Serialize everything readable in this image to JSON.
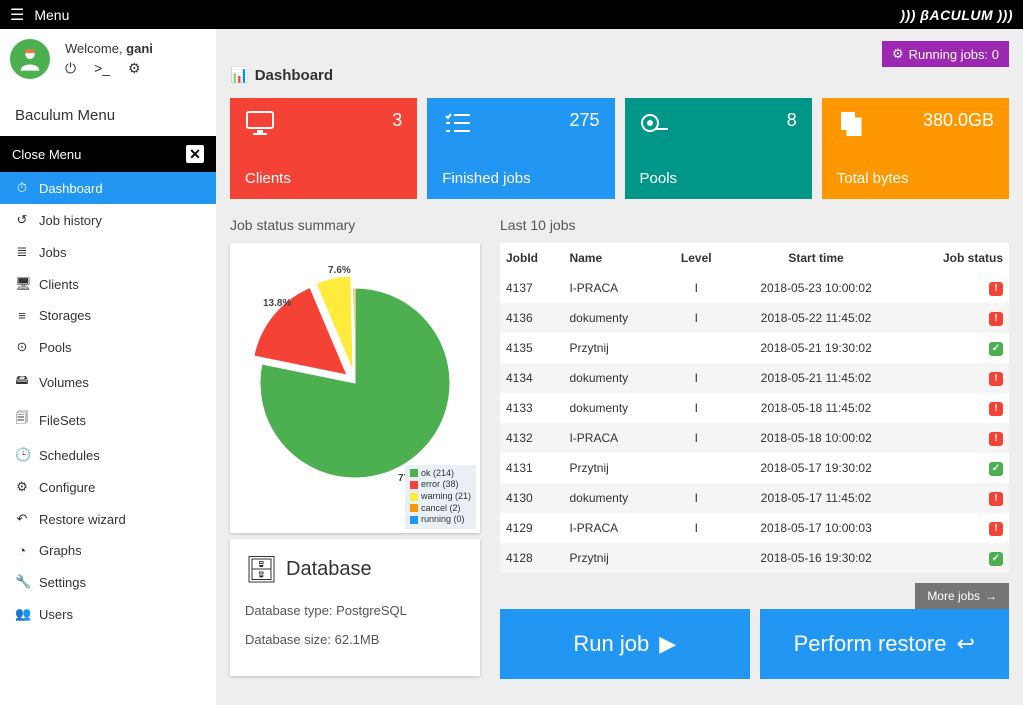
{
  "topbar": {
    "menu": "Menu",
    "brand": "))) βACULUM )))"
  },
  "user": {
    "welcome_prefix": "Welcome, ",
    "username": "gani"
  },
  "menu_title": "Baculum Menu",
  "close_menu": "Close Menu",
  "nav": [
    {
      "label": "Dashboard",
      "icon": "⏱",
      "active": true
    },
    {
      "label": "Job history",
      "icon": "↺",
      "active": false
    },
    {
      "label": "Jobs",
      "icon": "≣",
      "active": false
    },
    {
      "label": "Clients",
      "icon": "🖥",
      "active": false
    },
    {
      "label": "Storages",
      "icon": "≡",
      "active": false
    },
    {
      "label": "Pools",
      "icon": "⊙",
      "active": false
    },
    {
      "label": "Volumes",
      "icon": "🖴",
      "active": false
    },
    {
      "label": "FileSets",
      "icon": "🗐",
      "active": false
    },
    {
      "label": "Schedules",
      "icon": "🕒",
      "active": false
    },
    {
      "label": "Configure",
      "icon": "⚙",
      "active": false
    },
    {
      "label": "Restore wizard",
      "icon": "↶",
      "active": false
    },
    {
      "label": "Graphs",
      "icon": "◔",
      "active": false
    },
    {
      "label": "Settings",
      "icon": "🔧",
      "active": false
    },
    {
      "label": "Users",
      "icon": "👥",
      "active": false
    }
  ],
  "running_jobs": {
    "label": "Running jobs: ",
    "count": "0"
  },
  "dash_title": "Dashboard",
  "stats": [
    {
      "value": "3",
      "label": "Clients",
      "cls": "red",
      "icon": "monitor"
    },
    {
      "value": "275",
      "label": "Finished jobs",
      "cls": "blue",
      "icon": "list"
    },
    {
      "value": "8",
      "label": "Pools",
      "cls": "teal",
      "icon": "tape"
    },
    {
      "value": "380.0GB",
      "label": "Total bytes",
      "cls": "orange",
      "icon": "copy"
    }
  ],
  "sections": {
    "status_summary": "Job status summary",
    "last_jobs": "Last 10 jobs"
  },
  "chart_data": {
    "type": "pie",
    "title": "Job status summary",
    "series": [
      {
        "name": "ok",
        "count": 214,
        "percent": 77.8,
        "color": "#4CAF50"
      },
      {
        "name": "error",
        "count": 38,
        "percent": 13.8,
        "color": "#f44336"
      },
      {
        "name": "warning",
        "count": 21,
        "percent": 7.6,
        "color": "#ffeb3b"
      },
      {
        "name": "cancel",
        "count": 2,
        "percent": 0.7,
        "color": "#ff9800"
      },
      {
        "name": "running",
        "count": 0,
        "percent": 0.0,
        "color": "#2196F3"
      }
    ],
    "labels": {
      "l1": "77.8",
      "l2": "13.8%",
      "l3": "7.6%"
    }
  },
  "legend": [
    {
      "text": "ok (214)",
      "color": "#4CAF50"
    },
    {
      "text": "error (38)",
      "color": "#f44336"
    },
    {
      "text": "warning (21)",
      "color": "#ffeb3b"
    },
    {
      "text": "cancel (2)",
      "color": "#ff9800"
    },
    {
      "text": "running (0)",
      "color": "#2196F3"
    }
  ],
  "db": {
    "title": "Database",
    "type_label": "Database type: ",
    "type": "PostgreSQL",
    "size_label": "Database size: ",
    "size": "62.1MB"
  },
  "jobs_header": {
    "id": "JobId",
    "name": "Name",
    "level": "Level",
    "start": "Start time",
    "status": "Job status"
  },
  "jobs": [
    {
      "id": "4137",
      "name": "I-PRACA",
      "level": "I",
      "start": "2018-05-23 10:00:02",
      "status": "err"
    },
    {
      "id": "4136",
      "name": "dokumenty",
      "level": "I",
      "start": "2018-05-22 11:45:02",
      "status": "err"
    },
    {
      "id": "4135",
      "name": "Przytnij",
      "level": " ",
      "start": "2018-05-21 19:30:02",
      "status": "ok"
    },
    {
      "id": "4134",
      "name": "dokumenty",
      "level": "I",
      "start": "2018-05-21 11:45:02",
      "status": "err"
    },
    {
      "id": "4133",
      "name": "dokumenty",
      "level": "I",
      "start": "2018-05-18 11:45:02",
      "status": "err"
    },
    {
      "id": "4132",
      "name": "I-PRACA",
      "level": "I",
      "start": "2018-05-18 10:00:02",
      "status": "err"
    },
    {
      "id": "4131",
      "name": "Przytnij",
      "level": " ",
      "start": "2018-05-17 19:30:02",
      "status": "ok"
    },
    {
      "id": "4130",
      "name": "dokumenty",
      "level": "I",
      "start": "2018-05-17 11:45:02",
      "status": "err"
    },
    {
      "id": "4129",
      "name": "I-PRACA",
      "level": "I",
      "start": "2018-05-17 10:00:03",
      "status": "err"
    },
    {
      "id": "4128",
      "name": "Przytnij",
      "level": " ",
      "start": "2018-05-16 19:30:02",
      "status": "ok"
    }
  ],
  "more_jobs": "More jobs",
  "actions": {
    "run": "Run job",
    "restore": "Perform restore"
  }
}
